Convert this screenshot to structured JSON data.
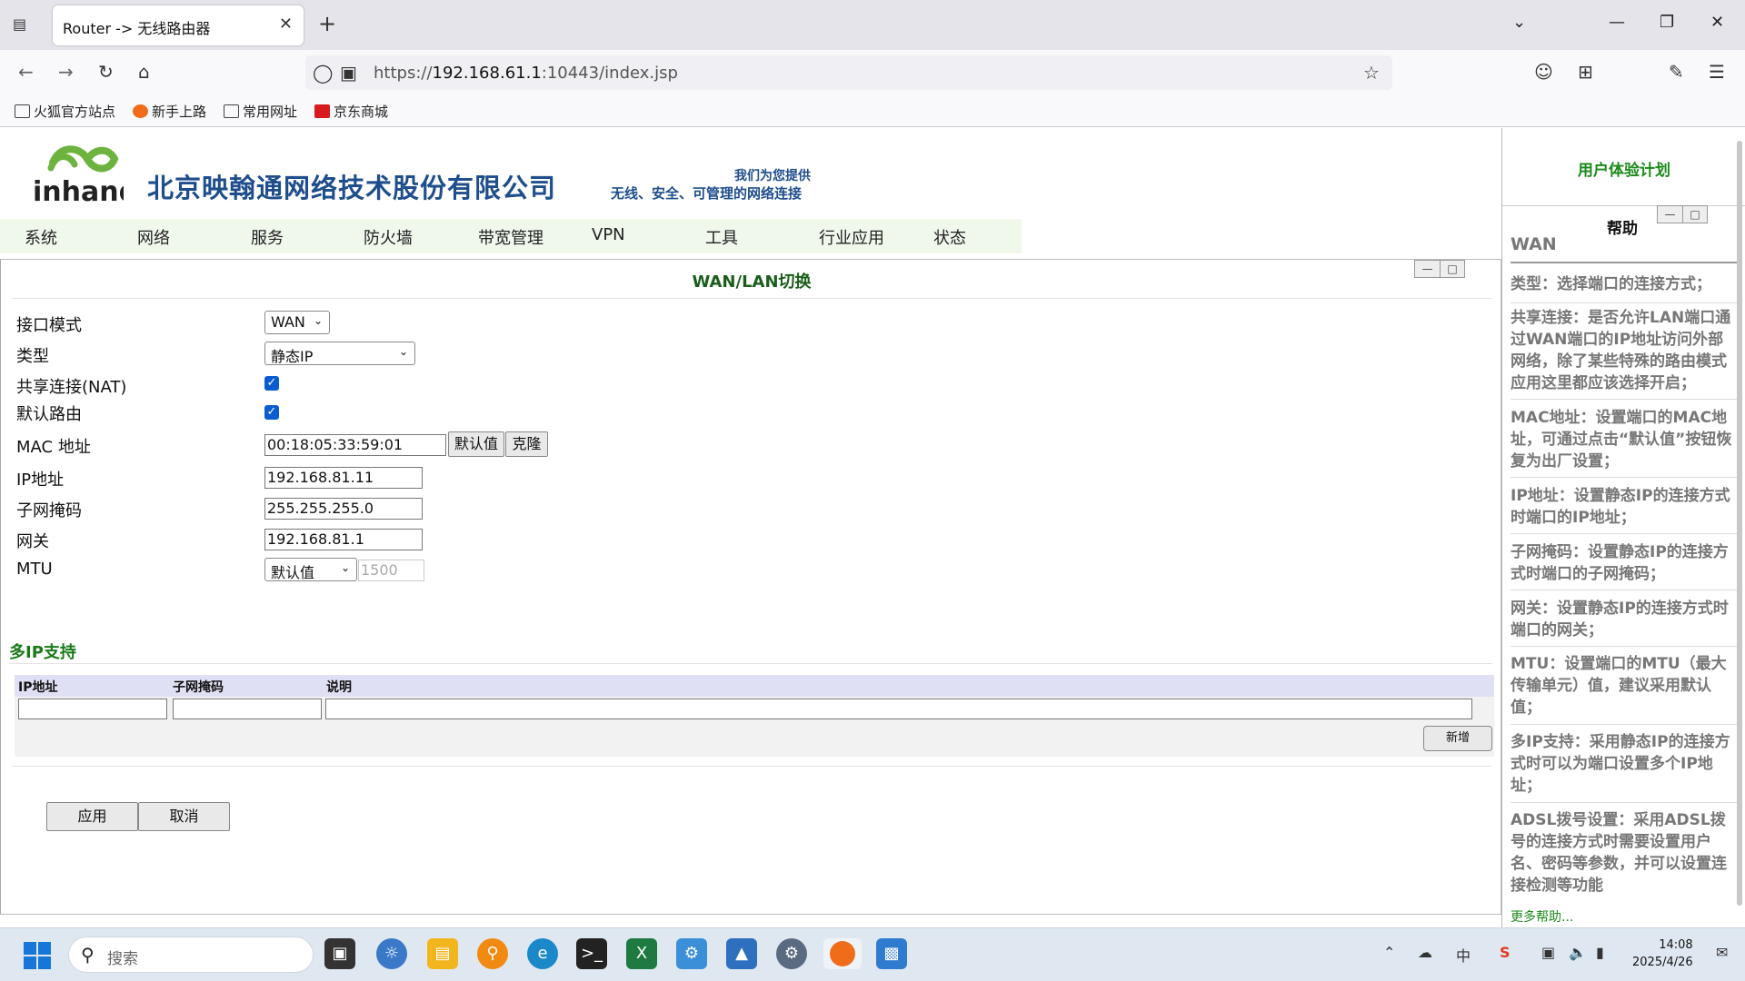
{
  "browser": {
    "tab_title": "Router -> 无线路由器",
    "url_prefix": "https://",
    "url_host": "192.168.61.1",
    "url_rest": ":10443/index.jsp",
    "bookmarks": [
      "火狐官方站点",
      "新手上路",
      "常用网址",
      "京东商城"
    ]
  },
  "header": {
    "company": "北京映翰通网络技术股份有限公司",
    "slogan_line1": "我们为您提供",
    "slogan_line2": "无线、安全、可管理的网络连接"
  },
  "menu": [
    "系统",
    "网络",
    "服务",
    "防火墙",
    "带宽管理",
    "VPN",
    "工具",
    "行业应用",
    "状态"
  ],
  "panel": {
    "title": "WAN/LAN切换",
    "fields": {
      "mode_label": "接口模式",
      "mode_value": "WAN",
      "type_label": "类型",
      "type_value": "静态IP",
      "nat_label": "共享连接(NAT)",
      "default_route_label": "默认路由",
      "mac_label": "MAC 地址",
      "mac_value": "00:18:05:33:59:01",
      "mac_default_btn": "默认值",
      "mac_clone_btn": "克隆",
      "ip_label": "IP地址",
      "ip_value": "192.168.81.11",
      "mask_label": "子网掩码",
      "mask_value": "255.255.255.0",
      "gw_label": "网关",
      "gw_value": "192.168.81.1",
      "mtu_label": "MTU",
      "mtu_select": "默认值",
      "mtu_value": "1500"
    },
    "multi_ip": {
      "title": "多IP支持",
      "columns": [
        "IP地址",
        "子网掩码",
        "说明"
      ],
      "add_btn": "新增"
    },
    "apply_btn": "应用",
    "cancel_btn": "取消"
  },
  "help": {
    "ux_plan": "用户体验计划",
    "title": "帮助",
    "section": "WAN",
    "paragraphs": [
      "类型：选择端口的连接方式；",
      "共享连接：是否允许LAN端口通过WAN端口的IP地址访问外部网络，除了某些特殊的路由模式应用这里都应该选择开启；",
      "MAC地址：设置端口的MAC地址，可通过点击“默认值”按钮恢复为出厂设置；",
      "IP地址：设置静态IP的连接方式时端口的IP地址；",
      "子网掩码：设置静态IP的连接方式时端口的子网掩码；",
      "网关：设置静态IP的连接方式时端口的网关；",
      "MTU：设置端口的MTU（最大传输单元）值，建议采用默认值；",
      "多IP支持：采用静态IP的连接方式时可以为端口设置多个IP地址；",
      "ADSL拨号设置：采用ADSL拨号的连接方式时需要设置用户名、密码等参数，并可以设置连接检测等功能"
    ],
    "more": "更多帮助..."
  },
  "taskbar": {
    "search_placeholder": "搜索",
    "time": "14:08",
    "date": "2025/4/26",
    "ime": "中"
  }
}
